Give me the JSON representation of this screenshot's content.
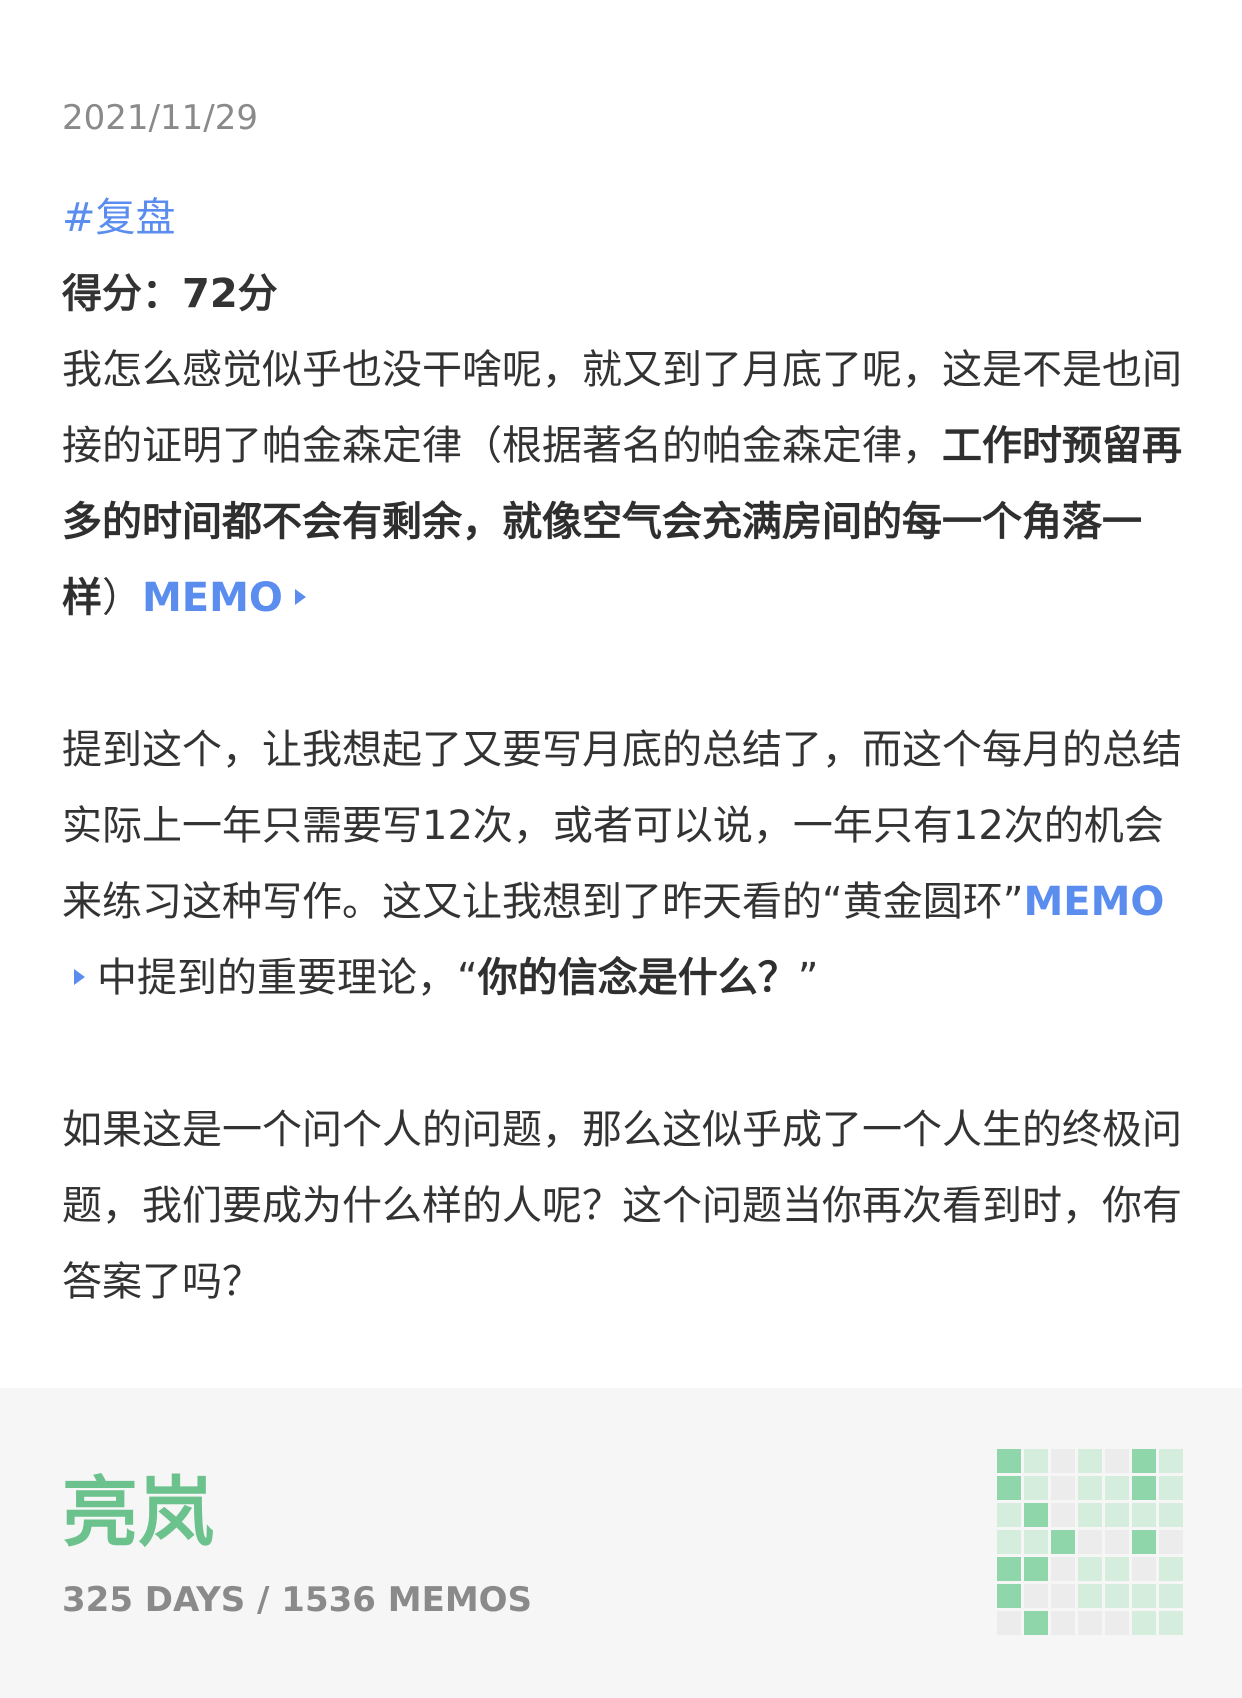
{
  "memo": {
    "date": "2021/11/29",
    "tag": "#复盘",
    "score": "得分：72分",
    "p1": {
      "text_a": "我怎么感觉似乎也没干啥呢，就又到了月底了呢，这是不是也间接的证明了帕金森定律（根据著名的帕金森定律，",
      "bold": "工作时预留再多的时间都不会有剩余，就像空气会充满房间的每一个角落一样",
      "text_b": "）"
    },
    "memo_link_label": "MEMO",
    "p2": {
      "text_a": "提到这个，让我想起了又要写月底的总结了，而这个每月的总结实际上一年只需要写12次，或者可以说，一年只有12次的机会来练习这种写作。这又让我想到了昨天看的“黄金圆环”",
      "text_b": "中提到的重要理论，“",
      "bold": "你的信念是什么？",
      "text_c": "”"
    },
    "p3": "如果这是一个问个人的问题，那么这似乎成了一个人生的终极问题，我们要成为什么样的人呢？这个问题当你再次看到时，你有答案了吗？"
  },
  "footer": {
    "author": "亮岚",
    "stats": "325 DAYS / 1536 MEMOS"
  },
  "heatmap": {
    "colors": [
      "#ececec",
      "#d4eddd",
      "#b7e2c5",
      "#8fd6aa"
    ],
    "levels": [
      [
        3,
        1,
        0,
        1,
        0,
        3,
        1
      ],
      [
        3,
        1,
        0,
        1,
        1,
        3,
        1
      ],
      [
        1,
        3,
        0,
        1,
        1,
        1,
        1
      ],
      [
        1,
        1,
        3,
        0,
        0,
        3,
        0
      ],
      [
        3,
        3,
        0,
        1,
        1,
        0,
        1
      ],
      [
        3,
        0,
        0,
        1,
        1,
        1,
        1
      ],
      [
        0,
        3,
        0,
        0,
        0,
        1,
        1
      ]
    ]
  }
}
